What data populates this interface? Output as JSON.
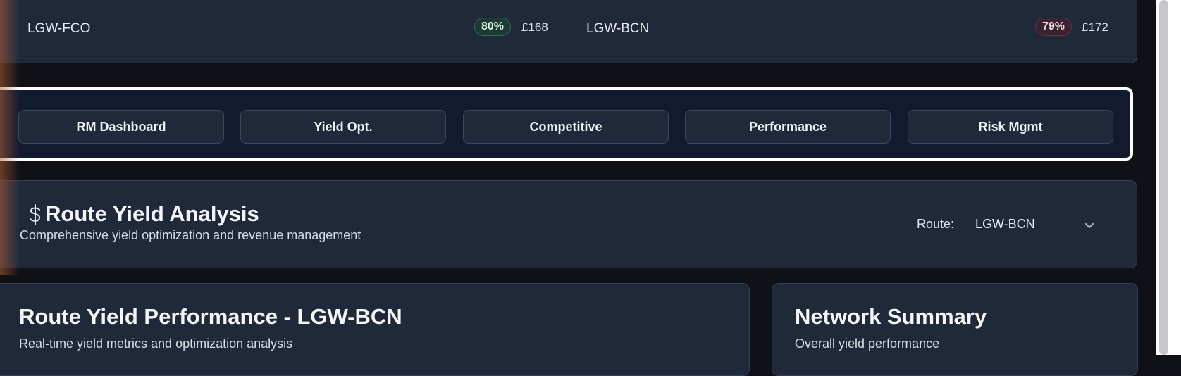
{
  "routes_preview": [
    {
      "code": "LGW-FCO",
      "load_factor": "80%",
      "status": "good",
      "price": "£168"
    },
    {
      "code": "LGW-BCN",
      "load_factor": "79%",
      "status": "warning",
      "price": "£172"
    }
  ],
  "nav_tabs": [
    {
      "label": "RM Dashboard"
    },
    {
      "label": "Yield Opt."
    },
    {
      "label": "Competitive"
    },
    {
      "label": "Performance"
    },
    {
      "label": "Risk Mgmt"
    }
  ],
  "header": {
    "icon": "dollar-icon",
    "title": "Route Yield Analysis",
    "subtitle": "Comprehensive yield optimization and revenue management",
    "route_label": "Route:",
    "route_selected": "LGW-BCN"
  },
  "performance_card": {
    "title": "Route Yield Performance - LGW-BCN",
    "subtitle": "Real-time yield metrics and optimization analysis"
  },
  "summary_card": {
    "title": "Network Summary",
    "subtitle": "Overall yield performance"
  },
  "colors": {
    "page_bg": "#0f1116",
    "card_bg": "#1f293a",
    "nav_bg": "#121a30",
    "badge_good": "#2e6b52",
    "badge_warning": "#6b2e44"
  }
}
